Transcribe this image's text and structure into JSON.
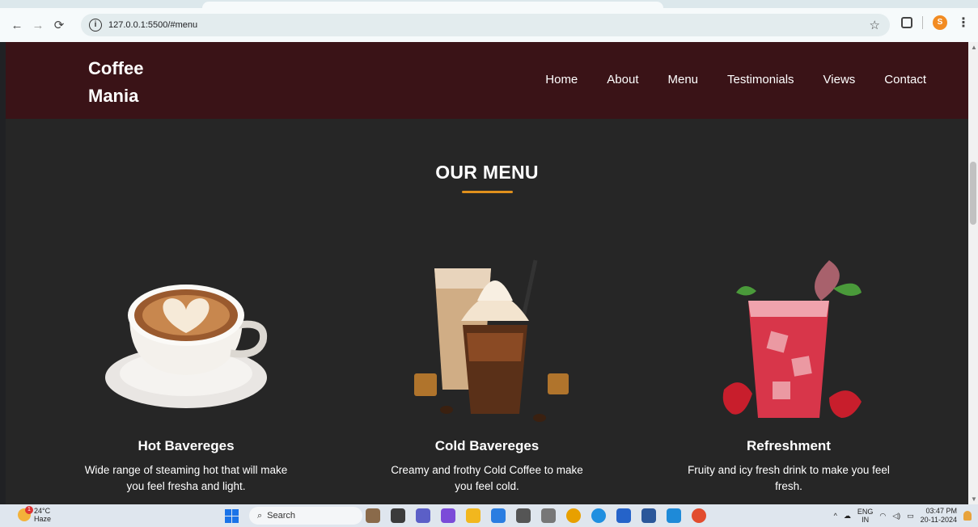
{
  "browser": {
    "url": "127.0.0.1:5500/#menu",
    "profile_initial": "S"
  },
  "site": {
    "logo_line1": "Coffee",
    "logo_line2": "Mania",
    "nav": [
      {
        "label": "Home"
      },
      {
        "label": "About"
      },
      {
        "label": "Menu"
      },
      {
        "label": "Testimonials"
      },
      {
        "label": "Views"
      },
      {
        "label": "Contact"
      }
    ]
  },
  "menu": {
    "title": "OUR MENU",
    "accent_color": "#e0901c",
    "items": [
      {
        "title": "Hot Bavereges",
        "description": "Wide range of steaming hot that will make you feel fresha and light.",
        "image": "latte-art-cup"
      },
      {
        "title": "Cold Bavereges",
        "description": "Creamy and frothy Cold Coffee to make you feel cold.",
        "image": "iced-coffee-glasses"
      },
      {
        "title": "Refreshment",
        "description": "Fruity and icy fresh drink to make you feel fresh.",
        "image": "strawberry-drink"
      }
    ]
  },
  "taskbar": {
    "temperature": "24°C",
    "weather": "Haze",
    "weather_badge": "1",
    "search_label": "Search",
    "lang_line1": "ENG",
    "lang_line2": "IN",
    "time": "03:47 PM",
    "date": "20-11-2024"
  },
  "colors": {
    "header_bg": "#3a1317",
    "page_bg": "#262626"
  }
}
